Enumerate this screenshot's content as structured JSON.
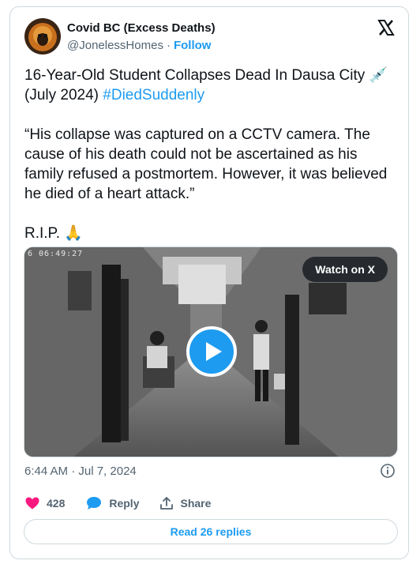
{
  "author": {
    "display_name": "Covid BC (Excess Deaths)",
    "handle": "@JonelessHomes",
    "separator": "·",
    "follow_label": "Follow"
  },
  "tweet": {
    "line1": "16-Year-Old Student Collapses Dead In Dausa City 💉",
    "line2_prefix": "(July 2024) ",
    "hashtag": "#DiedSuddenly",
    "quote": "“His collapse was captured on a CCTV camera. The cause of his death could not be ascertained as his family refused a postmortem. However, it was believed he died of a heart attack.”",
    "rip": "R.I.P. 🙏"
  },
  "media": {
    "cctv_timestamp": "6 06:49:27",
    "watch_label": "Watch on X"
  },
  "meta": {
    "timestamp": "6:44 AM · Jul 7, 2024"
  },
  "actions": {
    "like_count": "428",
    "reply_label": "Reply",
    "share_label": "Share"
  },
  "read_replies_label": "Read 26 replies",
  "colors": {
    "accent": "#1d9bf0",
    "like": "#f91880",
    "text": "#0f1419",
    "muted": "#536471",
    "border": "#cfd9de"
  },
  "icons": [
    "avatar",
    "x-logo-icon",
    "syringe-emoji",
    "pray-emoji",
    "play-icon",
    "info-icon",
    "heart-icon",
    "reply-bubble-icon",
    "share-icon"
  ]
}
